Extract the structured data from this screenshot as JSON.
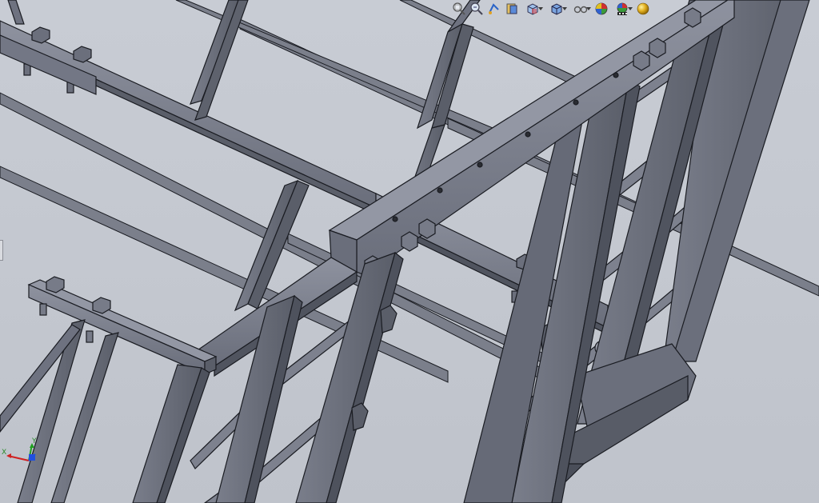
{
  "toolbar": {
    "items": [
      {
        "icon": "zoom-to-fit-icon"
      },
      {
        "icon": "zoom-to-area-icon"
      },
      {
        "icon": "previous-view-icon"
      },
      {
        "icon": "section-view-icon"
      },
      {
        "icon": "view-orientation-icon",
        "dropdown": true
      },
      {
        "icon": "display-style-icon",
        "dropdown": true
      },
      {
        "icon": "hide-show-items-icon",
        "dropdown": true
      },
      {
        "icon": "edit-appearance-icon"
      },
      {
        "icon": "apply-scene-icon",
        "dropdown": true
      },
      {
        "icon": "view-settings-icon"
      }
    ]
  },
  "triad": {
    "x_label": "X",
    "y_label": "Y",
    "x_color": "#d02020",
    "y_color": "#20a020",
    "z_color": "#2050e0"
  },
  "colors": {
    "background": "#c4c8d0",
    "steel_light": "#8e929f",
    "steel_mid": "#6e7280",
    "steel_dark": "#4e525d",
    "edge": "#1a1c22"
  }
}
